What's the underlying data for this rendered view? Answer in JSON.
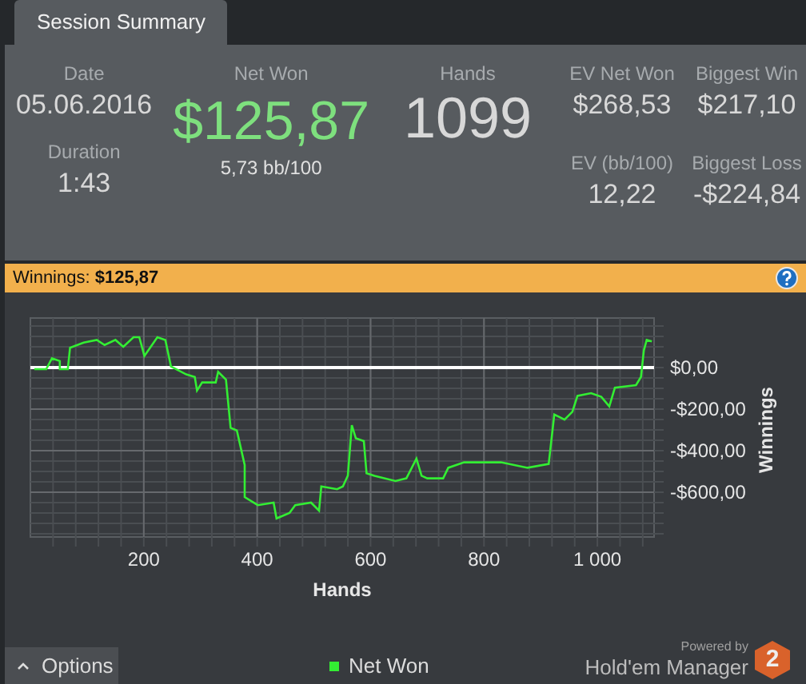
{
  "tab": {
    "label": "Session Summary",
    "selected": true
  },
  "summary": {
    "date": {
      "label": "Date",
      "value": "05.06.2016"
    },
    "duration": {
      "label": "Duration",
      "value": "1:43"
    },
    "net_won": {
      "label": "Net Won",
      "value": "$125,87",
      "rate": "5,73 bb/100"
    },
    "hands": {
      "label": "Hands",
      "value": "1099"
    },
    "ev_net_won": {
      "label": "EV Net Won",
      "value": "$268,53"
    },
    "biggest_win": {
      "label": "Biggest Win",
      "value": "$217,10"
    },
    "ev_bb100": {
      "label": "EV (bb/100)",
      "value": "12,22"
    },
    "biggest_loss": {
      "label": "Biggest Loss",
      "value": "-$224,84"
    }
  },
  "winnings_bar": {
    "label": "Winnings:",
    "value": "$125,87"
  },
  "chart": {
    "chart_data": {
      "type": "line",
      "grid": true,
      "xlabel": "Hands",
      "ylabel": "Winnings",
      "xlim": [
        0,
        1100
      ],
      "ylim": [
        -815,
        238
      ],
      "xticks": [
        200,
        400,
        600,
        800,
        {
          "value": 1000,
          "label": "1 000"
        }
      ],
      "yticks": [
        {
          "value": 0,
          "label": "$0,00"
        },
        {
          "value": -200,
          "label": "-$200,00"
        },
        {
          "value": -400,
          "label": "-$400,00"
        },
        {
          "value": -600,
          "label": "-$600,00"
        }
      ],
      "x": [
        7,
        28,
        38,
        52,
        52,
        66,
        70,
        94,
        117,
        131,
        150,
        164,
        182,
        192,
        201,
        224,
        238,
        248,
        275,
        290,
        294,
        303,
        327,
        331,
        345,
        353,
        364,
        378,
        378,
        401,
        429,
        434,
        457,
        467,
        495,
        509,
        513,
        541,
        551,
        560,
        567,
        574,
        588,
        593,
        607,
        644,
        663,
        681,
        690,
        700,
        728,
        737,
        765,
        830,
        877,
        914,
        924,
        933,
        942,
        956,
        965,
        989,
        1007,
        1021,
        1031,
        1068,
        1077,
        1082,
        1087,
        1096
      ],
      "series": [
        {
          "name": "Net Won",
          "color": "#33ee33",
          "values": [
            -8,
            -8,
            44,
            31,
            -8,
            -8,
            95,
            120,
            133,
            108,
            133,
            100,
            146,
            146,
            56,
            146,
            133,
            5,
            -33,
            -46,
            -110,
            -72,
            -72,
            -21,
            -59,
            -290,
            -303,
            -469,
            -623,
            -662,
            -650,
            -726,
            -700,
            -662,
            -650,
            -688,
            -572,
            -585,
            -572,
            -520,
            -277,
            -341,
            -354,
            -508,
            -521,
            -546,
            -533,
            -438,
            -521,
            -533,
            -533,
            -482,
            -456,
            -456,
            -482,
            -464,
            -226,
            -238,
            -251,
            -213,
            -136,
            -123,
            -141,
            -187,
            -97,
            -85,
            -46,
            82,
            133,
            126
          ]
        }
      ]
    }
  },
  "options_button": {
    "label": "Options"
  },
  "branding": {
    "powered_by": "Powered by",
    "product": "Hold'em Manager",
    "badge": "2"
  }
}
